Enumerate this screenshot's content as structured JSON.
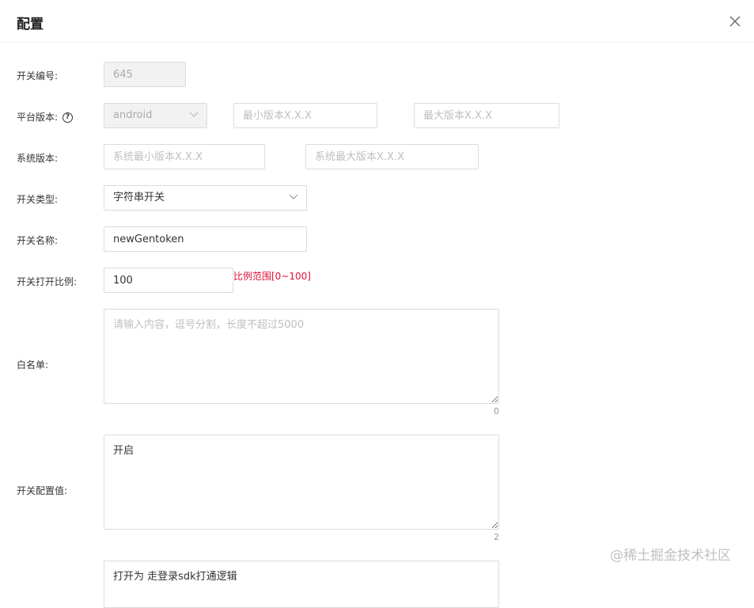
{
  "dialog": {
    "title": "配置",
    "close_icon": "close-icon"
  },
  "form": {
    "switch_id": {
      "label": "开关编号:",
      "value": "645"
    },
    "platform": {
      "label": "平台版本:",
      "help_icon": "question-circle-icon",
      "help_glyph": "?",
      "selected": "android",
      "min_placeholder": "最小版本X.X.X",
      "max_placeholder": "最大版本X.X.X"
    },
    "system": {
      "label": "系统版本:",
      "min_placeholder": "系统最小版本X.X.X",
      "max_placeholder": "系统最大版本X.X.X"
    },
    "switch_type": {
      "label": "开关类型:",
      "selected": "字符串开关"
    },
    "switch_name": {
      "label": "开关名称:",
      "value": "newGentoken"
    },
    "open_ratio": {
      "label": "开关打开比例:",
      "value": "100",
      "hint": "比例范围[0~100]"
    },
    "whitelist": {
      "label": "白名单:",
      "placeholder": "请输入内容，逗号分割，长度不超过5000",
      "value": "",
      "count": "0"
    },
    "config_value": {
      "label": "开关配置值:",
      "value": "开启",
      "count": "2"
    },
    "description": {
      "value": "打开为 走登录sdk打通逻辑"
    }
  },
  "watermark": "@稀土掘金技术社区"
}
